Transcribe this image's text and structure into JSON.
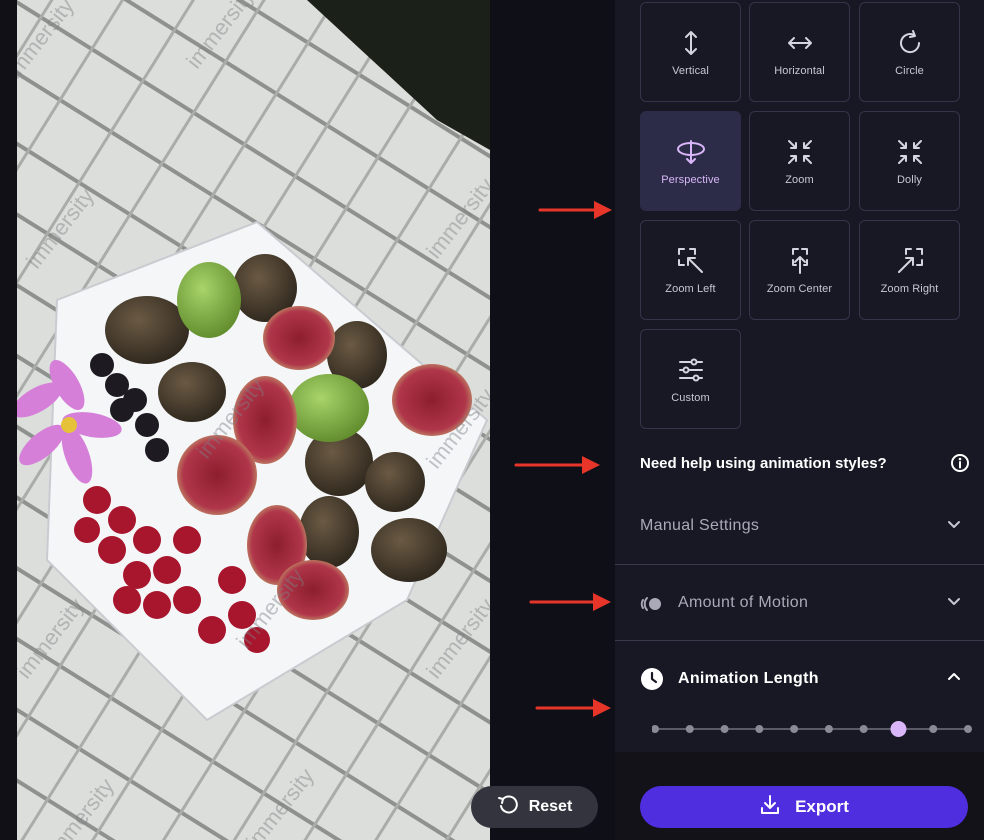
{
  "photo": {
    "watermark": "immersity"
  },
  "animation_styles": [
    {
      "label": "Vertical",
      "icon": "vertical-arrows-icon",
      "active": false
    },
    {
      "label": "Horizontal",
      "icon": "horizontal-arrows-icon",
      "active": false
    },
    {
      "label": "Circle",
      "icon": "circle-arrow-icon",
      "active": false
    },
    {
      "label": "Perspective",
      "icon": "perspective-orbit-icon",
      "active": true
    },
    {
      "label": "Zoom",
      "icon": "zoom-in-icon",
      "active": false
    },
    {
      "label": "Dolly",
      "icon": "dolly-icon",
      "active": false
    },
    {
      "label": "Zoom Left",
      "icon": "zoom-left-icon",
      "active": false
    },
    {
      "label": "Zoom Center",
      "icon": "zoom-center-icon",
      "active": false
    },
    {
      "label": "Zoom Right",
      "icon": "zoom-right-icon",
      "active": false
    },
    {
      "label": "Custom",
      "icon": "sliders-icon",
      "active": false
    }
  ],
  "help": {
    "text": "Need help using animation styles?",
    "icon": "info-icon"
  },
  "sections": {
    "manual_settings": {
      "title": "Manual Settings",
      "expanded": false
    },
    "amount_of_motion": {
      "title": "Amount of Motion",
      "icon": "motion-icon",
      "expanded": false
    },
    "animation_length": {
      "title": "Animation Length",
      "icon": "clock-icon",
      "expanded": true
    }
  },
  "animation_length_slider": {
    "steps": 10,
    "selected_step": 8
  },
  "buttons": {
    "reset": "Reset",
    "export": "Export"
  },
  "colors": {
    "accent": "#4f2ee0",
    "active_card": "#2d2c48",
    "active_text": "#d8b6f7",
    "annotation_arrow": "#e8352a"
  }
}
